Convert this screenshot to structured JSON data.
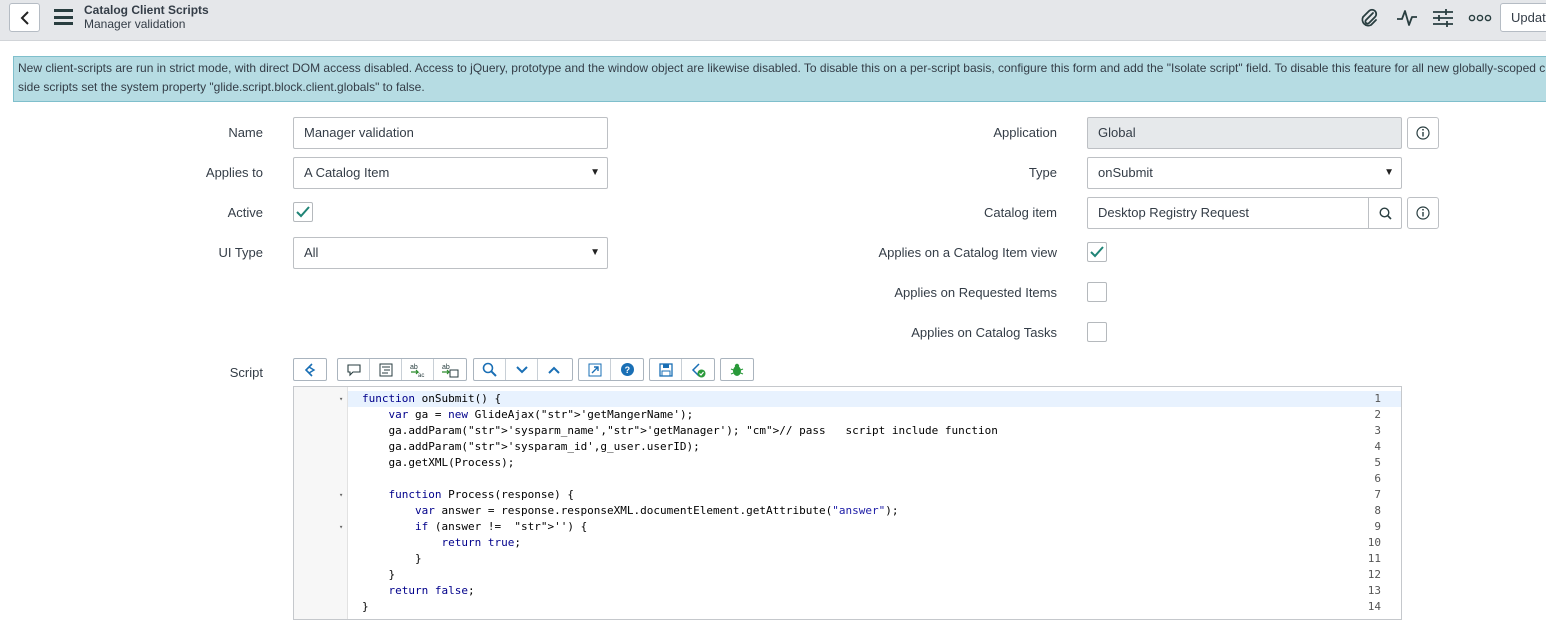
{
  "header": {
    "title": "Catalog Client Scripts",
    "subtitle": "Manager validation",
    "update_label": "Update",
    "icons": [
      "paperclip-icon",
      "activity-icon",
      "sliders-icon",
      "more-icon"
    ]
  },
  "info_message": {
    "line1": "New client-scripts are run in strict mode, with direct DOM access disabled. Access to jQuery, prototype and the window object are likewise disabled. To disable this on a per-script basis, configure this form and add the \"Isolate script\" field. To disable this feature for all new globally-scoped client-",
    "line2": "side scripts set the system property \"glide.script.block.client.globals\" to false."
  },
  "form": {
    "name": {
      "label": "Name",
      "value": "Manager validation"
    },
    "applies_to": {
      "label": "Applies to",
      "value": "A Catalog Item"
    },
    "active": {
      "label": "Active",
      "checked": true
    },
    "ui_type": {
      "label": "UI Type",
      "value": "All"
    },
    "application": {
      "label": "Application",
      "value": "Global"
    },
    "type": {
      "label": "Type",
      "value": "onSubmit"
    },
    "catalog_item": {
      "label": "Catalog item",
      "value": "Desktop Registry Request"
    },
    "applies_catalog_item_view": {
      "label": "Applies on a Catalog Item view",
      "checked": true
    },
    "applies_requested_items": {
      "label": "Applies on Requested Items",
      "checked": false
    },
    "applies_catalog_tasks": {
      "label": "Applies on Catalog Tasks",
      "checked": false
    },
    "script": {
      "label": "Script"
    }
  },
  "toolbar_icons": [
    "toggle-syntax-icon",
    "comment-icon",
    "format-code-icon",
    "replace-icon",
    "replace-all-icon",
    "search-icon",
    "next-icon",
    "previous-icon",
    "fullscreen-icon",
    "help-icon",
    "save-icon",
    "script-check-icon",
    "debug-icon"
  ],
  "accent_color": "#1f8476",
  "code_lines": [
    "function onSubmit() {",
    "    var ga = new GlideAjax('getMangerName');",
    "    ga.addParam('sysparm_name','getManager'); // pass   script include function",
    "    ga.addParam('sysparam_id',g_user.userID);",
    "    ga.getXML(Process);",
    "",
    "    function Process(response) {",
    "        var answer = response.responseXML.documentElement.getAttribute(\"answer\");",
    "        if (answer !=  '') {",
    "            return true;",
    "        }",
    "    }",
    "    return false;",
    "}"
  ],
  "line_numbers": [
    "1",
    "2",
    "3",
    "4",
    "5",
    "6",
    "7",
    "8",
    "9",
    "10",
    "11",
    "12",
    "13",
    "14"
  ],
  "fold_marker": "▾"
}
